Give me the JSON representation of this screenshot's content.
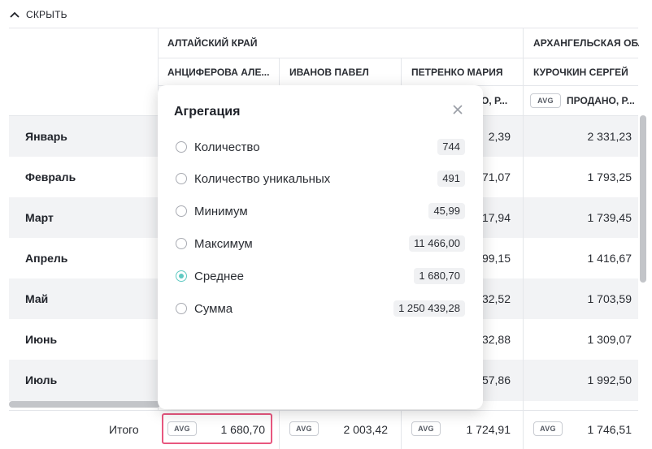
{
  "toolbar": {
    "hide_label": "СКРЫТЬ"
  },
  "regions": [
    "АЛТАЙСКИЙ КРАЙ",
    "АРХАНГЕЛЬСКАЯ ОБЛ"
  ],
  "persons": [
    "АНЦИФЕРОВА АЛЕ...",
    "ИВАНОВ ПАВЕЛ",
    "ПЕТРЕНКО МАРИЯ",
    "КУРОЧКИН СЕРГЕЙ"
  ],
  "metric": {
    "badge": "AVG",
    "col3_partial": "О, Р...",
    "col4": "ПРОДАНО, Р..."
  },
  "months": [
    "Январь",
    "Февраль",
    "Март",
    "Апрель",
    "Май",
    "Июнь",
    "Июль"
  ],
  "col3_partial_values": [
    "2,39",
    "71,07",
    "17,94",
    "99,15",
    "32,52",
    "32,88",
    "57,86"
  ],
  "col4_values": [
    "2 331,23",
    "1 793,25",
    "1 739,45",
    "1 416,67",
    "1 703,59",
    "1 309,07",
    "1 992,50"
  ],
  "totals": {
    "label": "Итого",
    "badge": "AVG",
    "values": [
      "1 680,70",
      "2 003,42",
      "1 724,91",
      "1 746,51"
    ]
  },
  "popup": {
    "title": "Агрегация",
    "options": [
      {
        "label": "Количество",
        "count": "744",
        "selected": false
      },
      {
        "label": "Количество уникальных",
        "count": "491",
        "selected": false
      },
      {
        "label": "Минимум",
        "count": "45,99",
        "selected": false
      },
      {
        "label": "Максимум",
        "count": "11 466,00",
        "selected": false
      },
      {
        "label": "Среднее",
        "count": "1 680,70",
        "selected": true
      },
      {
        "label": "Сумма",
        "count": "1 250 439,28",
        "selected": false
      }
    ]
  },
  "colors": {
    "accent": "#5fc9c2",
    "highlight": "#e8577f",
    "stripe": "#f2f3f5"
  }
}
